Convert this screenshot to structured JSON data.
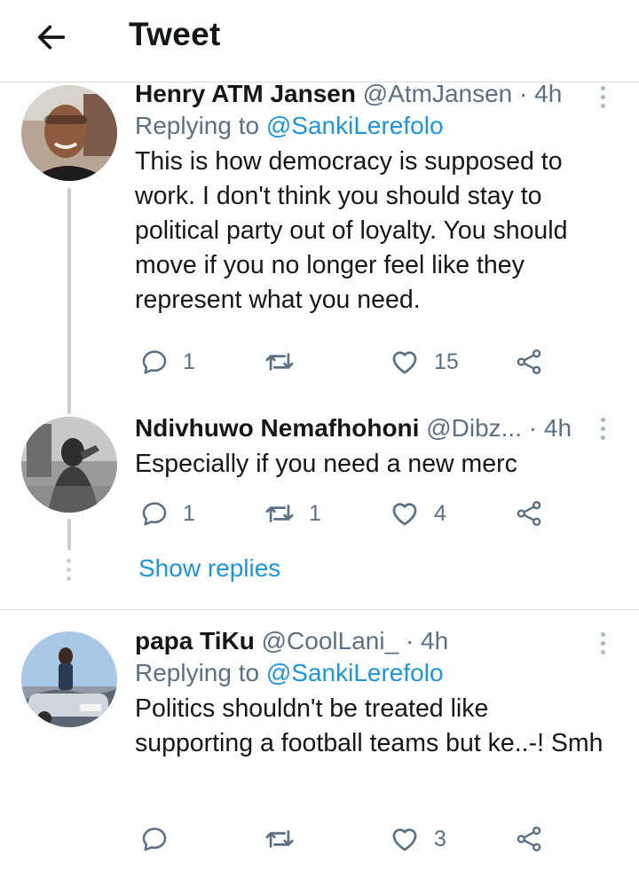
{
  "header": {
    "title": "Tweet"
  },
  "tweets": [
    {
      "display_name": "Henry ATM Jansen",
      "handle": "@AtmJansen",
      "dot": "·",
      "time": "4h",
      "replying_prefix": "Replying to",
      "replying_to": "@SankiLerefolo",
      "text": "This is how democracy is supposed to work. I don't think you should stay to political party out of loyalty. You should move if you no longer feel like they represent what you need.",
      "replies": "1",
      "retweets": "",
      "likes": "15"
    },
    {
      "display_name": "Ndivhuwo Nemafhohoni",
      "handle": "@Dibz...",
      "dot": "·",
      "time": "4h",
      "text": "Especially if you need a new merc",
      "replies": "1",
      "retweets": "1",
      "likes": "4"
    },
    {
      "display_name": "papa TiKu",
      "handle": "@CoolLani_",
      "dot": "·",
      "time": "4h",
      "replying_prefix": "Replying to",
      "replying_to": "@SankiLerefolo",
      "text": "Politics shouldn't be treated like supporting a football teams but ke..-! Smh",
      "replies": "",
      "retweets": "",
      "likes": "3"
    }
  ],
  "thread": {
    "show_replies_label": "Show replies"
  },
  "icons": {
    "back": "arrow-left-icon",
    "reply": "reply-icon",
    "retweet": "retweet-icon",
    "like": "heart-icon",
    "share": "share-icon",
    "more": "more-vertical-icon"
  },
  "colors": {
    "text": "#14171a",
    "muted": "#5b7083",
    "link": "#1b95e0",
    "divider": "#d9dde1"
  }
}
